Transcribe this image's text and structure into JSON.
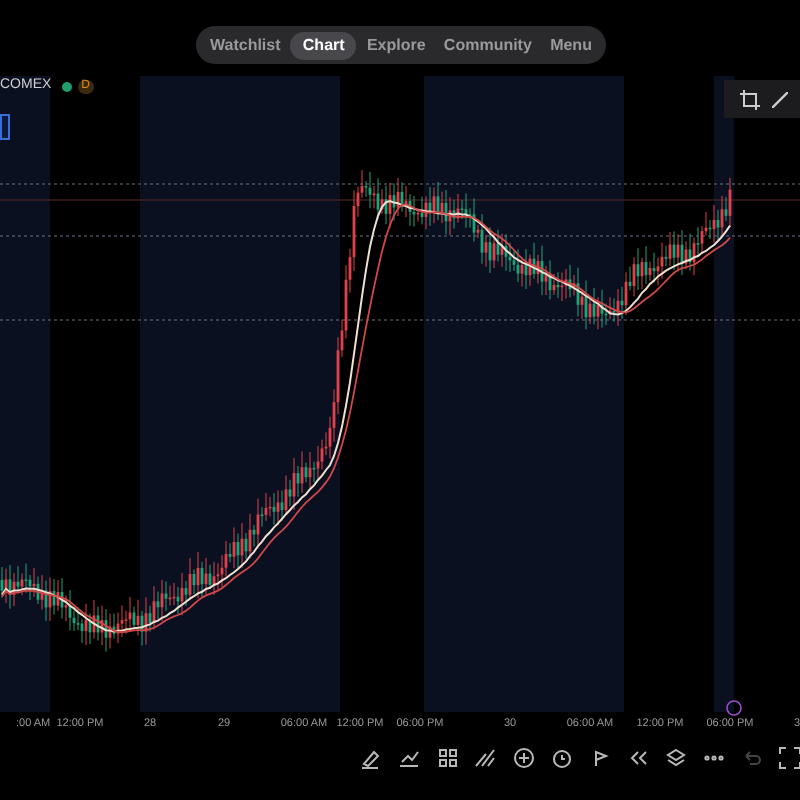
{
  "nav": {
    "tabs": [
      {
        "label": "Watchlist",
        "selected": false
      },
      {
        "label": "Chart",
        "selected": true
      },
      {
        "label": "Explore",
        "selected": false
      },
      {
        "label": "Community",
        "selected": false
      },
      {
        "label": "Menu",
        "selected": false
      }
    ]
  },
  "legend": {
    "symbol": "COMEX",
    "color": "#1f9d6a",
    "badge": "D"
  },
  "time_axis": [
    ":00 AM",
    "12:00 PM",
    "28",
    "29",
    "06:00 AM",
    "12:00 PM",
    "06:00 PM",
    "30",
    "06:00 AM",
    "12:00 PM",
    "06:00 PM",
    "3"
  ],
  "toolbar": [
    {
      "kind": "brush",
      "disabled": false
    },
    {
      "kind": "indicator",
      "disabled": false
    },
    {
      "kind": "grid",
      "disabled": false
    },
    {
      "kind": "lines",
      "disabled": false
    },
    {
      "kind": "plus",
      "disabled": false
    },
    {
      "kind": "alarm",
      "disabled": false
    },
    {
      "kind": "replay",
      "disabled": false
    },
    {
      "kind": "rewind",
      "disabled": false
    },
    {
      "kind": "layers",
      "disabled": false
    },
    {
      "kind": "more",
      "disabled": false
    },
    {
      "kind": "undo",
      "disabled": true
    },
    {
      "kind": "fullscreen",
      "disabled": false
    }
  ]
}
